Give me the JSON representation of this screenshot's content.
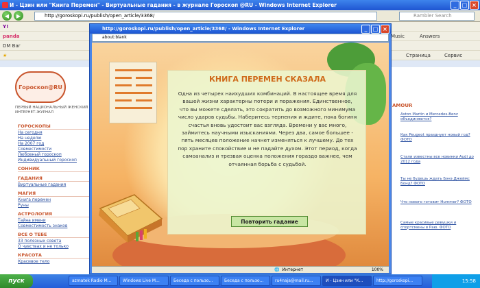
{
  "outer_window": {
    "title": "И - Цзин или \"Книга Перемен\" - Виртуальные гадания - в журнале Гороскоп @RU - Windows Internet Explorer",
    "address": "http://goroskopi.ru/publish/open_article/3368/",
    "search_placeholder": "Rambler Search"
  },
  "toolbar": {
    "music": "Music",
    "answers": "Answers",
    "page_menu": "Страница",
    "service_menu": "Сервис"
  },
  "left_page": {
    "logo": "Гороскоп@RU",
    "tagline": "ПЕРВЫЙ НАЦИОНАЛЬНЫЙ ЖЕНСКИЙ ИНТЕРНЕТ-ЖУРНАЛ",
    "menu": [
      {
        "type": "cat",
        "label": "ГОРОСКОПЫ"
      },
      {
        "type": "link",
        "label": "На сегодня"
      },
      {
        "type": "link",
        "label": "На неделю"
      },
      {
        "type": "link",
        "label": "На 2007 год"
      },
      {
        "type": "link",
        "label": "Совместимости"
      },
      {
        "type": "link",
        "label": "Любовный гороскоп"
      },
      {
        "type": "link",
        "label": "Индивидуальный гороскоп"
      },
      {
        "type": "cat",
        "label": "СОННИК"
      },
      {
        "type": "cat",
        "label": "ГАДАНИЯ"
      },
      {
        "type": "link",
        "label": "Виртуальные гадания"
      },
      {
        "type": "cat",
        "label": "МАГИЯ"
      },
      {
        "type": "link",
        "label": "Книга перемен"
      },
      {
        "type": "link",
        "label": "Руны"
      },
      {
        "type": "cat",
        "label": "АСТРОЛОГИЯ"
      },
      {
        "type": "link",
        "label": "Тайна имени"
      },
      {
        "type": "link",
        "label": "Совместимость знаков"
      },
      {
        "type": "cat",
        "label": "ВСЕ О ТЕБЕ"
      },
      {
        "type": "link",
        "label": "33 полезных совета"
      },
      {
        "type": "link",
        "label": "О чувствах и не только"
      },
      {
        "type": "cat",
        "label": "КРАСОТА"
      },
      {
        "type": "link",
        "label": "Красивое тело"
      }
    ]
  },
  "right_strip": {
    "heading": "AMOUR",
    "items": [
      "Aston Martin и Mercedes-Benz объединяются?",
      "Как Peugeot празднует новый год? ФОТО",
      "Стали известны все новинки Audi до 2012 года",
      "Ты не будешь ждать Бэнэ Джеймс Бонд? ФОТО",
      "Что нового готовит Hummer? ФОТО",
      "Самые красивые девушки и спортсмены в Раю. ФОТО"
    ]
  },
  "inner_window": {
    "title": "http://goroskopi.ru/publish/open_article/3368/ - Windows Internet Explorer",
    "address": "about:blank",
    "status_zone": "Интернет",
    "zoom": "100%"
  },
  "oracle": {
    "title": "КНИГА ПЕРЕМЕН СКАЗАЛА",
    "body": "Одна из четырех наихудших комбинаций. В настоящее время для вашей жизни характерны потери и поражения. Единственное, что вы можете сделать, это сократить до возможного минимума число ударов судьбы. Наберитесь терпения и ждите, пока богиня счастья вновь удостоит вас взгляда. Времени у вас много, займитесь научными изысканиями. Через два, самое большее - пять месяцев положение начнет изменяться к лучшему. До тех пор храните спокойствие и не падайте духом. Этот период, когда самоанализ и трезвая оценка положения гораздо важнее, чем отчаянная борьба с судьбой.",
    "button": "Повторить гадание"
  },
  "taskbar": {
    "start": "пуск",
    "tasks": [
      "azmatek Radio M...",
      "Windows Live M...",
      "Беседа с пользо...",
      "Беседа с пользо...",
      "ru4naja@mail.ru...",
      "И - Цзин или \"К...",
      "http://goroskopi..."
    ],
    "clock": "15:58"
  }
}
